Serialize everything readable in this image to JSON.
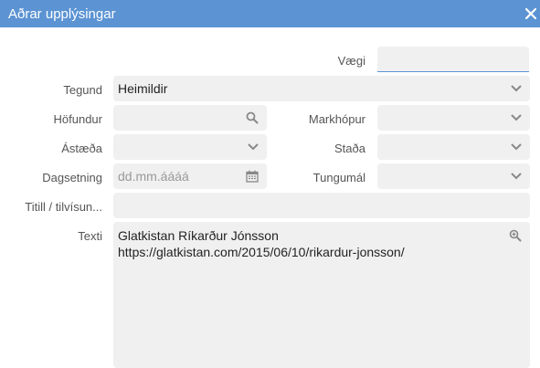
{
  "window": {
    "title": "Aðrar upplýsingar",
    "close_icon": "close-icon"
  },
  "form": {
    "vaegi": {
      "label": "Vægi",
      "value": ""
    },
    "tegund": {
      "label": "Tegund",
      "value": "Heimildir"
    },
    "hofundur": {
      "label": "Höfundur",
      "value": ""
    },
    "markhopur": {
      "label": "Markhópur",
      "value": ""
    },
    "astaeda": {
      "label": "Ástæða",
      "value": ""
    },
    "stada": {
      "label": "Staða",
      "value": ""
    },
    "dagsetning": {
      "label": "Dagsetning",
      "placeholder": "dd.mm.áááá"
    },
    "tungumal": {
      "label": "Tungumál",
      "value": ""
    },
    "titill": {
      "label": "Titill / tilvísun...",
      "value": ""
    },
    "texti": {
      "label": "Texti",
      "lines": [
        "Glatkistan Ríkarður Jónsson",
        "https://glatkistan.com/2015/06/10/rikardur-jonsson/"
      ]
    }
  },
  "colors": {
    "titlebar": "#5b93d3",
    "field": "#f0f0f0"
  }
}
